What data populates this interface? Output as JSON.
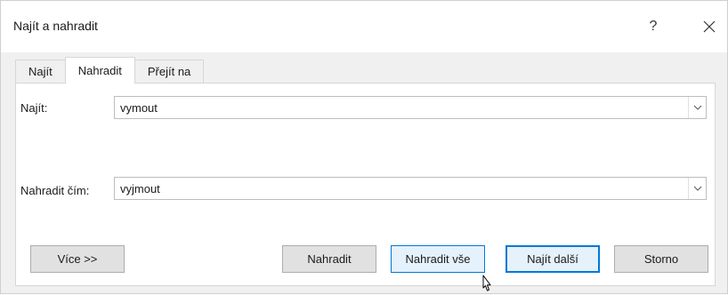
{
  "window": {
    "title": "Najít a nahradit",
    "help_label": "?"
  },
  "tabs": [
    {
      "label": "Najít",
      "active": false
    },
    {
      "label": "Nahradit",
      "active": true
    },
    {
      "label": "Přejít na",
      "active": false
    }
  ],
  "find": {
    "label": "Najít:",
    "value": "vymout"
  },
  "replace": {
    "label": "Nahradit čím:",
    "value": "vyjmout"
  },
  "buttons": {
    "more": "Více >>",
    "replace": "Nahradit",
    "replace_all": "Nahradit vše",
    "find_next": "Najít další",
    "cancel": "Storno"
  },
  "icons": {
    "close": "close-icon",
    "dropdown": "chevron-down-icon",
    "cursor": "mouse-pointer-icon"
  }
}
